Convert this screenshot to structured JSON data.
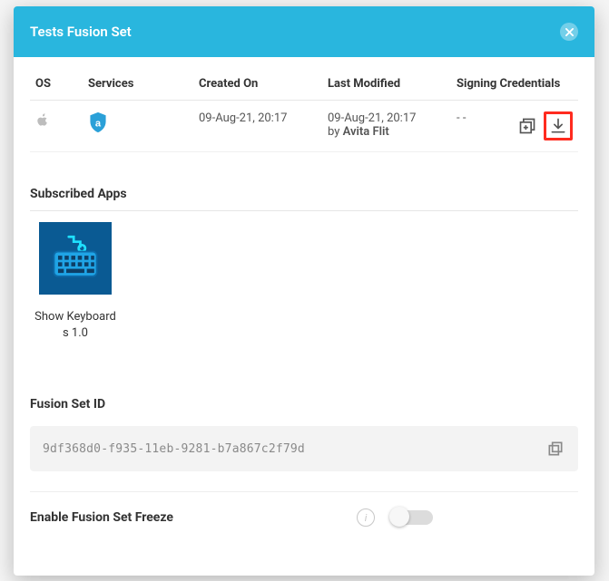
{
  "header": {
    "title": "Tests Fusion Set"
  },
  "table": {
    "headers": {
      "os": "OS",
      "services": "Services",
      "created": "Created On",
      "modified": "Last Modified",
      "creds": "Signing Credentials"
    },
    "row": {
      "created": "09-Aug-21, 20:17",
      "modified_date": "09-Aug-21, 20:17",
      "modified_prefix": "by ",
      "modified_by": "Avita Flit",
      "creds": "- -"
    }
  },
  "sections": {
    "subscribed": "Subscribed Apps",
    "fusion_id": "Fusion Set ID",
    "freeze": "Enable Fusion Set Freeze"
  },
  "app": {
    "name_line1": "Show Keyboard",
    "name_line2": "s 1.0"
  },
  "fusion_id_value": "9df368d0-f935-11eb-9281-b7a867c2f79d"
}
